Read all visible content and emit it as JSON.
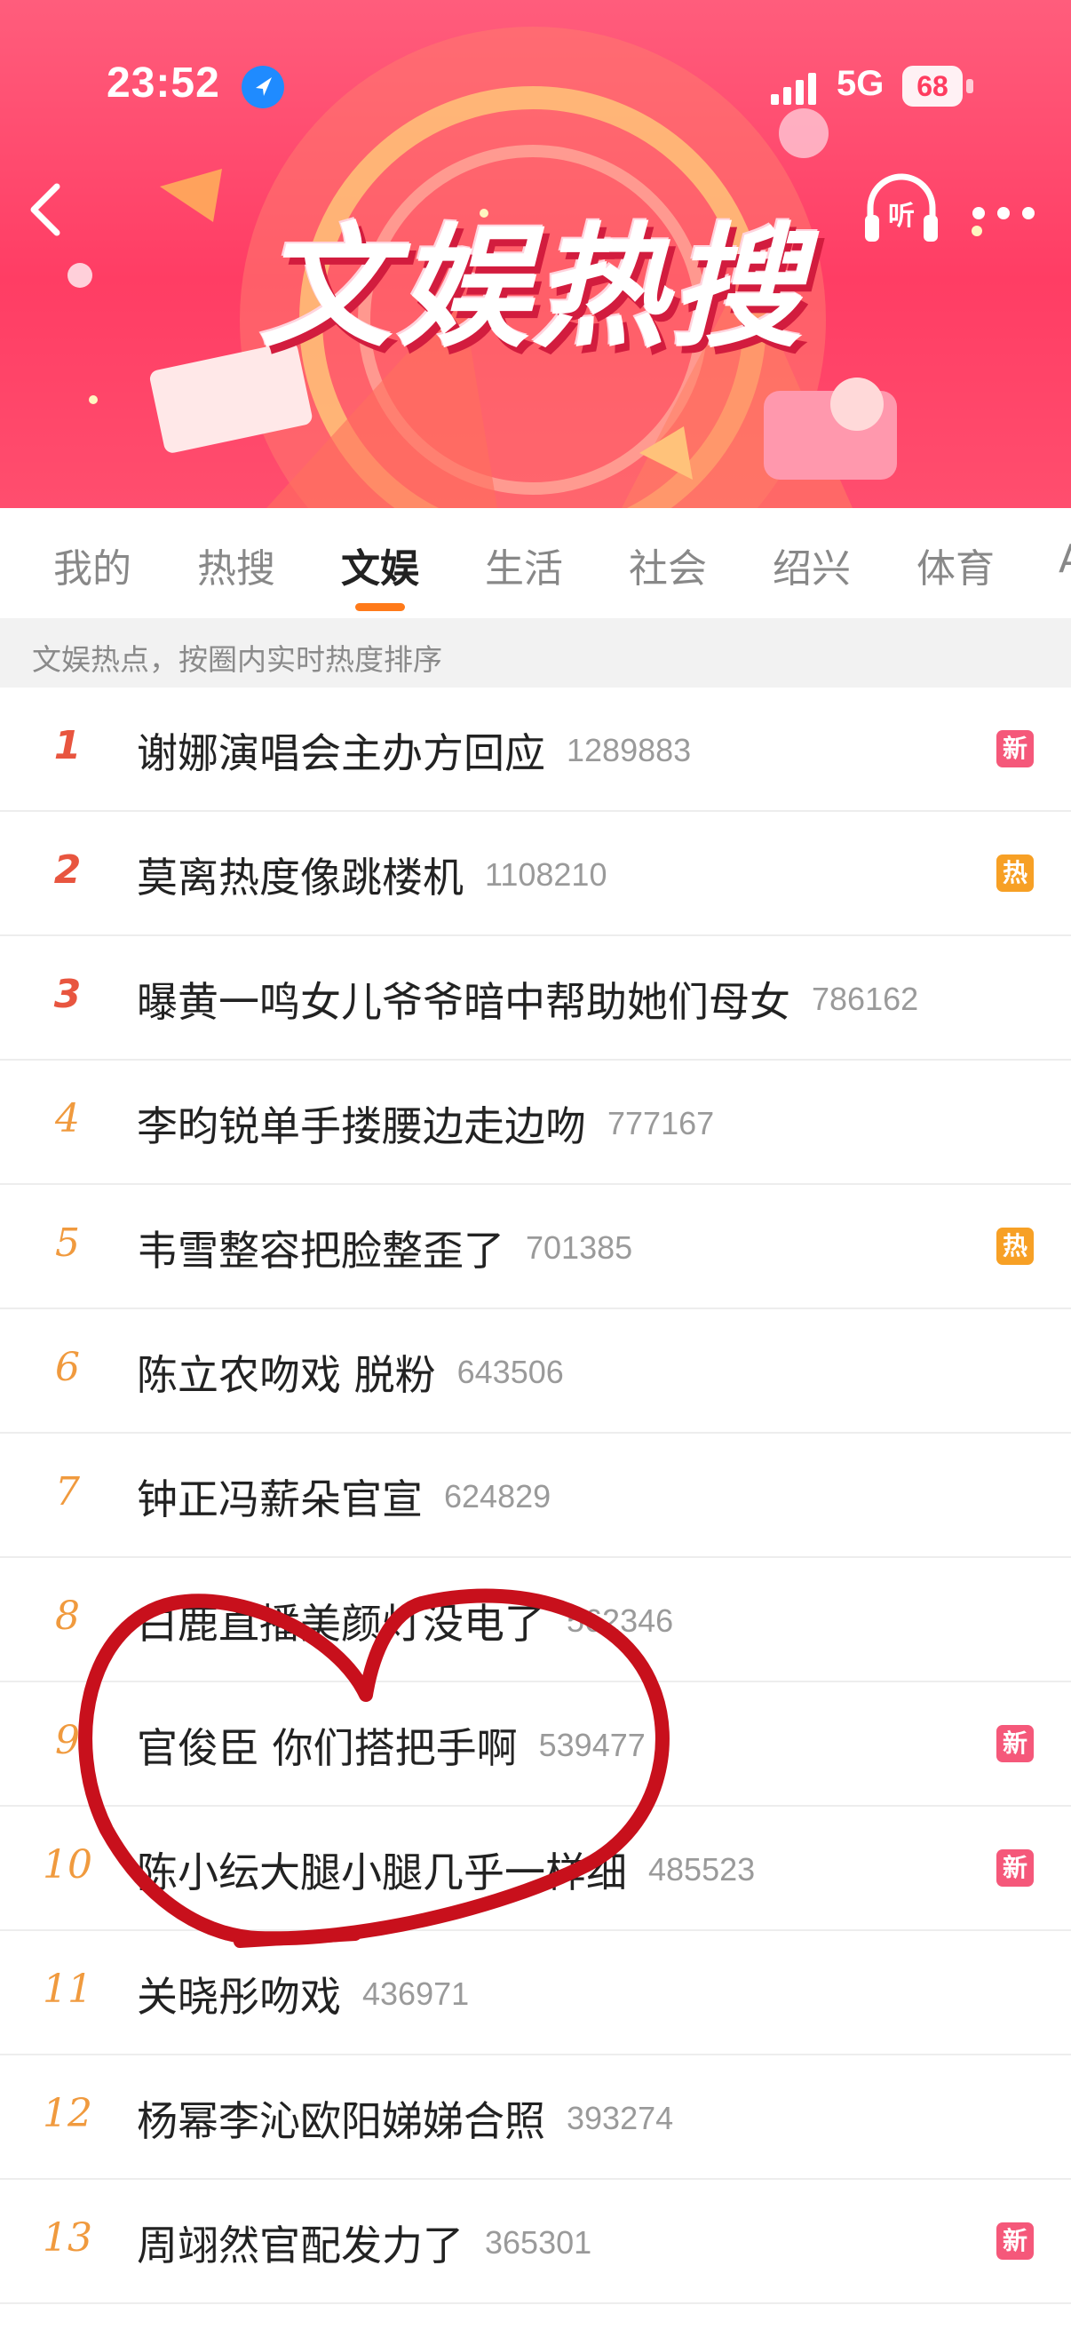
{
  "status_bar": {
    "time": "23:52",
    "network": "5G",
    "battery": "68"
  },
  "banner": {
    "title": "文娱热搜"
  },
  "header": {
    "listen_label": "听"
  },
  "tabs": [
    {
      "label": "我的"
    },
    {
      "label": "热搜"
    },
    {
      "label": "文娱"
    },
    {
      "label": "生活"
    },
    {
      "label": "社会"
    },
    {
      "label": "绍兴"
    },
    {
      "label": "体育"
    },
    {
      "label": "A"
    }
  ],
  "active_tab": "文娱",
  "notice": "文娱热点，按圈内实时热度排序",
  "list": [
    {
      "rank": "1",
      "topic": "谢娜演唱会主办方回应",
      "heat": "1289883",
      "badge": "新"
    },
    {
      "rank": "2",
      "topic": "莫离热度像跳楼机",
      "heat": "1108210",
      "badge": "热"
    },
    {
      "rank": "3",
      "topic": "曝黄一鸣女儿爷爷暗中帮助她们母女",
      "heat": "786162",
      "badge": ""
    },
    {
      "rank": "4",
      "topic": "李昀锐单手搂腰边走边吻",
      "heat": "777167",
      "badge": ""
    },
    {
      "rank": "5",
      "topic": "韦雪整容把脸整歪了",
      "heat": "701385",
      "badge": "热"
    },
    {
      "rank": "6",
      "topic": "陈立农吻戏 脱粉",
      "heat": "643506",
      "badge": ""
    },
    {
      "rank": "7",
      "topic": "钟正冯薪朵官宣",
      "heat": "624829",
      "badge": ""
    },
    {
      "rank": "8",
      "topic": "白鹿直播美颜灯没电了",
      "heat": "562346",
      "badge": ""
    },
    {
      "rank": "9",
      "topic": "官俊臣 你们搭把手啊",
      "heat": "539477",
      "badge": "新"
    },
    {
      "rank": "10",
      "topic": "陈小纭大腿小腿几乎一样细",
      "heat": "485523",
      "badge": "新"
    },
    {
      "rank": "11",
      "topic": "关晓彤吻戏",
      "heat": "436971",
      "badge": ""
    },
    {
      "rank": "12",
      "topic": "杨幂李沁欧阳娣娣合照",
      "heat": "393274",
      "badge": ""
    },
    {
      "rank": "13",
      "topic": "周翊然官配发力了",
      "heat": "365301",
      "badge": "新"
    }
  ],
  "colors": {
    "banner": "#ff4466",
    "accent": "#ff7a1a",
    "rank_top": "#e8553f",
    "rank": "#f09a3e",
    "badge_new": "#f5587a",
    "badge_hot": "#f7a025",
    "annotation": "#c8101c"
  },
  "icons": {
    "back": "chevron-left-icon",
    "location": "location-arrow-icon",
    "listen": "headphones-icon",
    "more": "more-dots-icon"
  }
}
